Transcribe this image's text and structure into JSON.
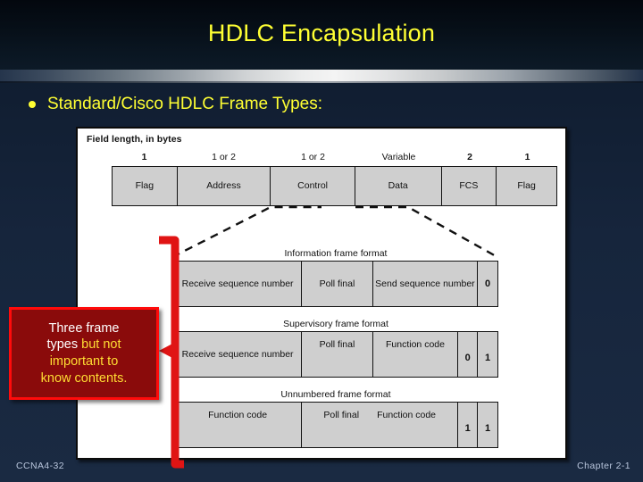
{
  "slide": {
    "title": "HDLC Encapsulation",
    "bullet": "Standard/Cisco HDLC Frame Types:",
    "accent_yellow": "#ffff33",
    "background": "#16253c"
  },
  "diagram": {
    "field_length_label": "Field length, in bytes",
    "top_frame": {
      "lengths": [
        "1",
        "1 or 2",
        "1 or 2",
        "Variable",
        "2",
        "1"
      ],
      "fields": [
        "Flag",
        "Address",
        "Control",
        "Data",
        "FCS",
        "Flag"
      ]
    },
    "information_frame": {
      "label": "Information frame format",
      "cells": [
        "Receive sequence number",
        "Poll final",
        "Send sequence number"
      ],
      "bits": [
        "0"
      ]
    },
    "supervisory_frame": {
      "label": "Supervisory frame format",
      "cells": [
        "Receive sequence number",
        "Poll final",
        "Function code"
      ],
      "bits": [
        "0",
        "1"
      ]
    },
    "unnumbered_frame": {
      "label": "Unnumbered frame format",
      "cells": [
        "Function code",
        "Poll final",
        "Function code"
      ],
      "bits": [
        "1",
        "1"
      ]
    }
  },
  "callout": {
    "line1": "Three frame",
    "line2a": "types ",
    "line2b": "but not",
    "line3": "important to",
    "line4": "know contents.",
    "fill": "#8a0b0b",
    "border": "#ff0b0b",
    "text_color": "#ffffff",
    "highlight_color": "#ffdd33"
  },
  "footer": {
    "left": "CCNA4-32",
    "right": "Chapter 2-1"
  }
}
